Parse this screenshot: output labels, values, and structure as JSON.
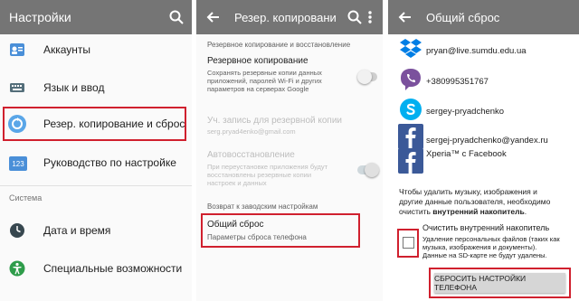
{
  "panel1": {
    "title": "Настройки",
    "items": [
      {
        "label": "Аккаунты",
        "icon": "accounts-icon"
      },
      {
        "label": "Язык и ввод",
        "icon": "keyboard-icon"
      },
      {
        "label": "Резер. копирование и сброс",
        "icon": "backup-icon"
      },
      {
        "label": "Руководство по настройке",
        "icon": "guide-123-icon"
      }
    ],
    "system_header": "Система",
    "system_items": [
      {
        "label": "Дата и время",
        "icon": "clock-icon"
      },
      {
        "label": "Специальные возможности",
        "icon": "accessibility-icon"
      }
    ],
    "guide_icon_text": "123"
  },
  "panel2": {
    "title": "Резер. копировани...",
    "section1": "Резервное копирование и восстановление",
    "backup_title": "Резервное копирование",
    "backup_desc": [
      "Сохранять резервные копии данных",
      "приложений, паролей Wi-Fi и других",
      "параметров на серверах Google"
    ],
    "account_title": "Уч. запись для резервной копии",
    "account_value": "serg.pryad4enko@gmail.com",
    "restore_title": "Автовосстановление",
    "restore_desc": [
      "При переустановке приложения будут",
      "восстановлены резервные копии",
      "настроек и данных"
    ],
    "section2": "Возврат к заводским настройкам",
    "reset_title": "Общий сброс",
    "reset_desc": "Параметры сброса телефона"
  },
  "panel3": {
    "title": "Общий сброс",
    "accounts": [
      {
        "text": "pryan@live.sumdu.edu.ua",
        "icon": "dropbox-icon"
      },
      {
        "text": "+380995351767",
        "icon": "viber-icon"
      },
      {
        "text": "sergey-pryadchenko",
        "icon": "skype-icon"
      },
      {
        "text": "sergej-pryadchenko@yandex.ru",
        "icon": "facebook-icon"
      },
      {
        "text": "Xperia™ с Facebook",
        "icon": "facebook-xperia-icon"
      }
    ],
    "warning_lines": [
      "Чтобы удалить музыку, изображения и",
      "другие данные пользователя, необходимо",
      "очистить "
    ],
    "warning_bold": "внутренний накопитель",
    "warning_end": ".",
    "erase_title": "Очистить внутренний накопитель",
    "erase_desc": [
      "Удаление персональных файлов (таких как",
      "музыка, изображения и документы).",
      "Данные на SD-карте не будут удалены."
    ],
    "reset_button": "СБРОСИТЬ НАСТРОЙКИ ТЕЛЕФОНА"
  },
  "colors": {
    "appbar": "#757575",
    "highlight": "#d0202e",
    "facebook": "#3b5998",
    "skype": "#00aff0",
    "viber": "#7b519d",
    "dropbox": "#007ee5"
  }
}
